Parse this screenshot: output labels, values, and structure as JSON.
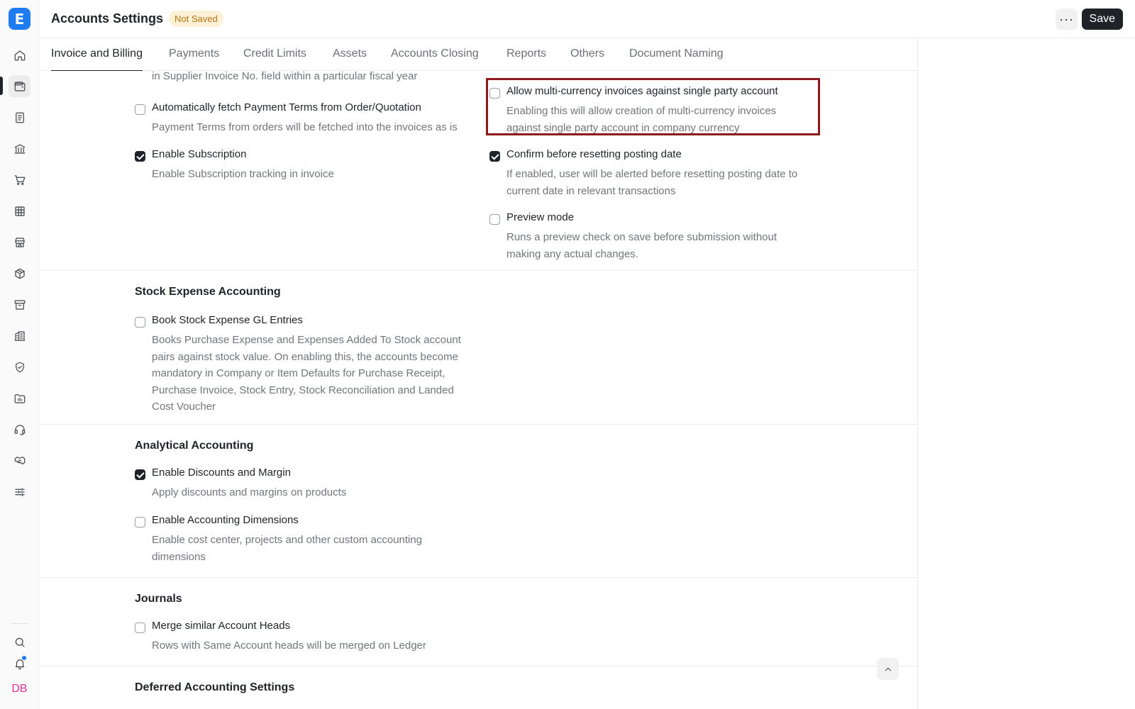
{
  "app": {
    "logo_letter": "E",
    "avatar_initials": "DB"
  },
  "header": {
    "title": "Accounts Settings",
    "status_badge": "Not Saved",
    "more_label": "···",
    "save_label": "Save"
  },
  "sidebar": {
    "items": [
      {
        "icon": "home-icon"
      },
      {
        "icon": "wallet-icon",
        "active": true
      },
      {
        "icon": "document-icon"
      },
      {
        "icon": "bank-icon"
      },
      {
        "icon": "cart-icon"
      },
      {
        "icon": "table-icon"
      },
      {
        "icon": "store-icon"
      },
      {
        "icon": "box-icon"
      },
      {
        "icon": "archive-icon"
      },
      {
        "icon": "building-icon"
      },
      {
        "icon": "shield-icon"
      },
      {
        "icon": "folder-chart-icon"
      },
      {
        "icon": "headset-icon"
      },
      {
        "icon": "handshake-icon"
      },
      {
        "icon": "sliders-icon"
      }
    ],
    "bottom": [
      {
        "icon": "search-icon"
      },
      {
        "icon": "bell-icon",
        "has_notification": true
      }
    ]
  },
  "tabs": [
    {
      "label": "Invoice and Billing",
      "active": true
    },
    {
      "label": "Payments"
    },
    {
      "label": "Credit Limits"
    },
    {
      "label": "Assets"
    },
    {
      "label": "Accounts Closing"
    },
    {
      "label": "Reports"
    },
    {
      "label": "Others"
    },
    {
      "label": "Document Naming"
    }
  ],
  "invoice_section": {
    "cut_off_description": "in Supplier Invoice No. field within a particular fiscal year",
    "left_fields": [
      {
        "label": "Automatically fetch Payment Terms from Order/Quotation",
        "description": "Payment Terms from orders will be fetched into the invoices as is",
        "checked": false
      },
      {
        "label": "Enable Subscription",
        "description": "Enable Subscription tracking in invoice",
        "checked": true
      }
    ],
    "right_fields": [
      {
        "label": "Allow multi-currency invoices against single party account",
        "description": "Enabling this will allow creation of multi-currency invoices against single party account in company currency",
        "checked": false,
        "highlighted": true
      },
      {
        "label": "Confirm before resetting posting date",
        "description": "If enabled, user will be alerted before resetting posting date to current date in relevant transactions",
        "checked": true
      },
      {
        "label": "Preview mode",
        "description": "Runs a preview check on save before submission without making any actual changes.",
        "checked": false
      }
    ]
  },
  "stock_section": {
    "title": "Stock Expense Accounting",
    "fields": [
      {
        "label": "Book Stock Expense GL Entries",
        "description": "Books Purchase Expense and Expenses Added To Stock account pairs against stock value. On enabling this, the accounts become mandatory in Company or Item Defaults for Purchase Receipt, Purchase Invoice, Stock Entry, Stock Reconciliation and Landed Cost Voucher",
        "checked": false
      }
    ]
  },
  "analytical_section": {
    "title": "Analytical Accounting",
    "fields": [
      {
        "label": "Enable Discounts and Margin",
        "description": "Apply discounts and margins on products",
        "checked": true
      },
      {
        "label": "Enable Accounting Dimensions",
        "description": "Enable cost center, projects and other custom accounting dimensions",
        "checked": false
      }
    ]
  },
  "journals_section": {
    "title": "Journals",
    "fields": [
      {
        "label": "Merge similar Account Heads",
        "description": "Rows with Same Account heads will be merged on Ledger",
        "checked": false
      }
    ]
  },
  "deferred_section": {
    "title": "Deferred Accounting Settings"
  }
}
